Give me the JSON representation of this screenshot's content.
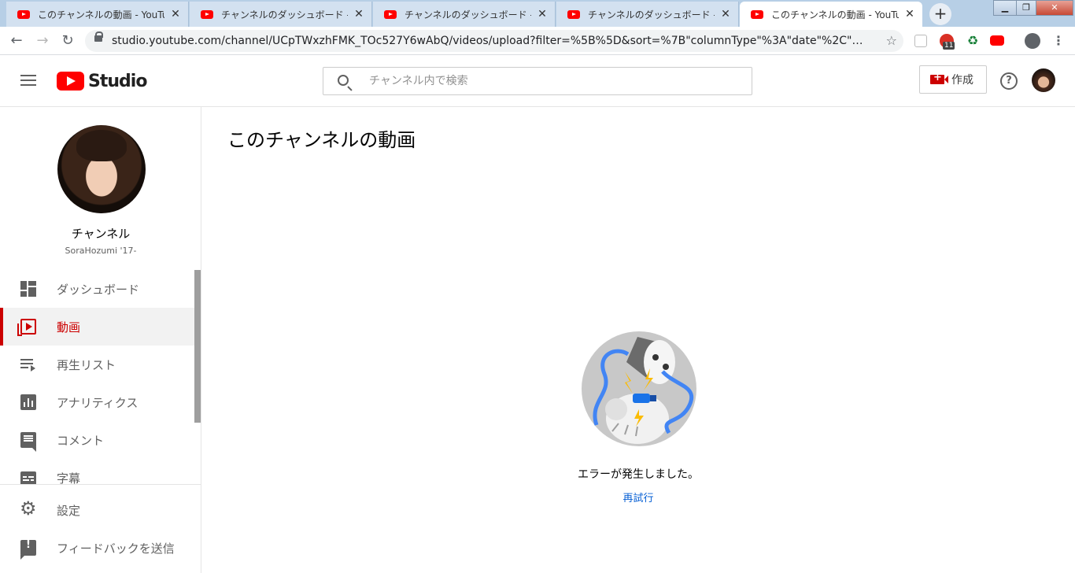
{
  "browser": {
    "tabs": [
      {
        "title": "このチャンネルの動画 - YouTube Studio",
        "active": false
      },
      {
        "title": "チャンネルのダッシュボード - YouTube Studio",
        "active": false
      },
      {
        "title": "チャンネルのダッシュボード - YouTube Studio",
        "active": false
      },
      {
        "title": "チャンネルのダッシュボード - YouTube Studio",
        "active": false
      },
      {
        "title": "このチャンネルの動画 - YouTube Studio",
        "active": true
      }
    ],
    "close_glyph": "✕",
    "new_tab_glyph": "+",
    "url": "studio.youtube.com/channel/UCpTWxzhFMK_TOc527Y6wAbQ/videos/upload?filter=%5B%5D&sort=%7B\"columnType\"%3A\"date\"%2C\"sor…",
    "extension_badge": "11",
    "icons": [
      "back-icon",
      "forward-icon",
      "reload-icon",
      "lock-icon",
      "star-icon",
      "account-icon",
      "menu-icon"
    ]
  },
  "header": {
    "logo_text": "Studio",
    "search_placeholder": "チャンネル内で検索",
    "create_label": "作成",
    "help_glyph": "?"
  },
  "sidebar": {
    "channel_label": "チャンネル",
    "channel_handle": "SoraHozumi '17-",
    "items": [
      {
        "label": "ダッシュボード",
        "icon": "dashboard-icon",
        "active": false
      },
      {
        "label": "動画",
        "icon": "video-icon",
        "active": true
      },
      {
        "label": "再生リスト",
        "icon": "playlist-icon",
        "active": false
      },
      {
        "label": "アナリティクス",
        "icon": "analytics-icon",
        "active": false
      },
      {
        "label": "コメント",
        "icon": "comment-icon",
        "active": false
      },
      {
        "label": "字幕",
        "icon": "subtitles-icon",
        "active": false
      }
    ],
    "bottom_items": [
      {
        "label": "設定",
        "icon": "gear-icon"
      },
      {
        "label": "フィードバックを送信",
        "icon": "feedback-icon"
      }
    ]
  },
  "main": {
    "title": "このチャンネルの動画",
    "error_message": "エラーが発生しました。",
    "retry_label": "再試行"
  },
  "colors": {
    "brand_red": "#ff0000",
    "active_red": "#cc0000",
    "link_blue": "#065fd4",
    "tabstrip": "#b7cfe6"
  }
}
